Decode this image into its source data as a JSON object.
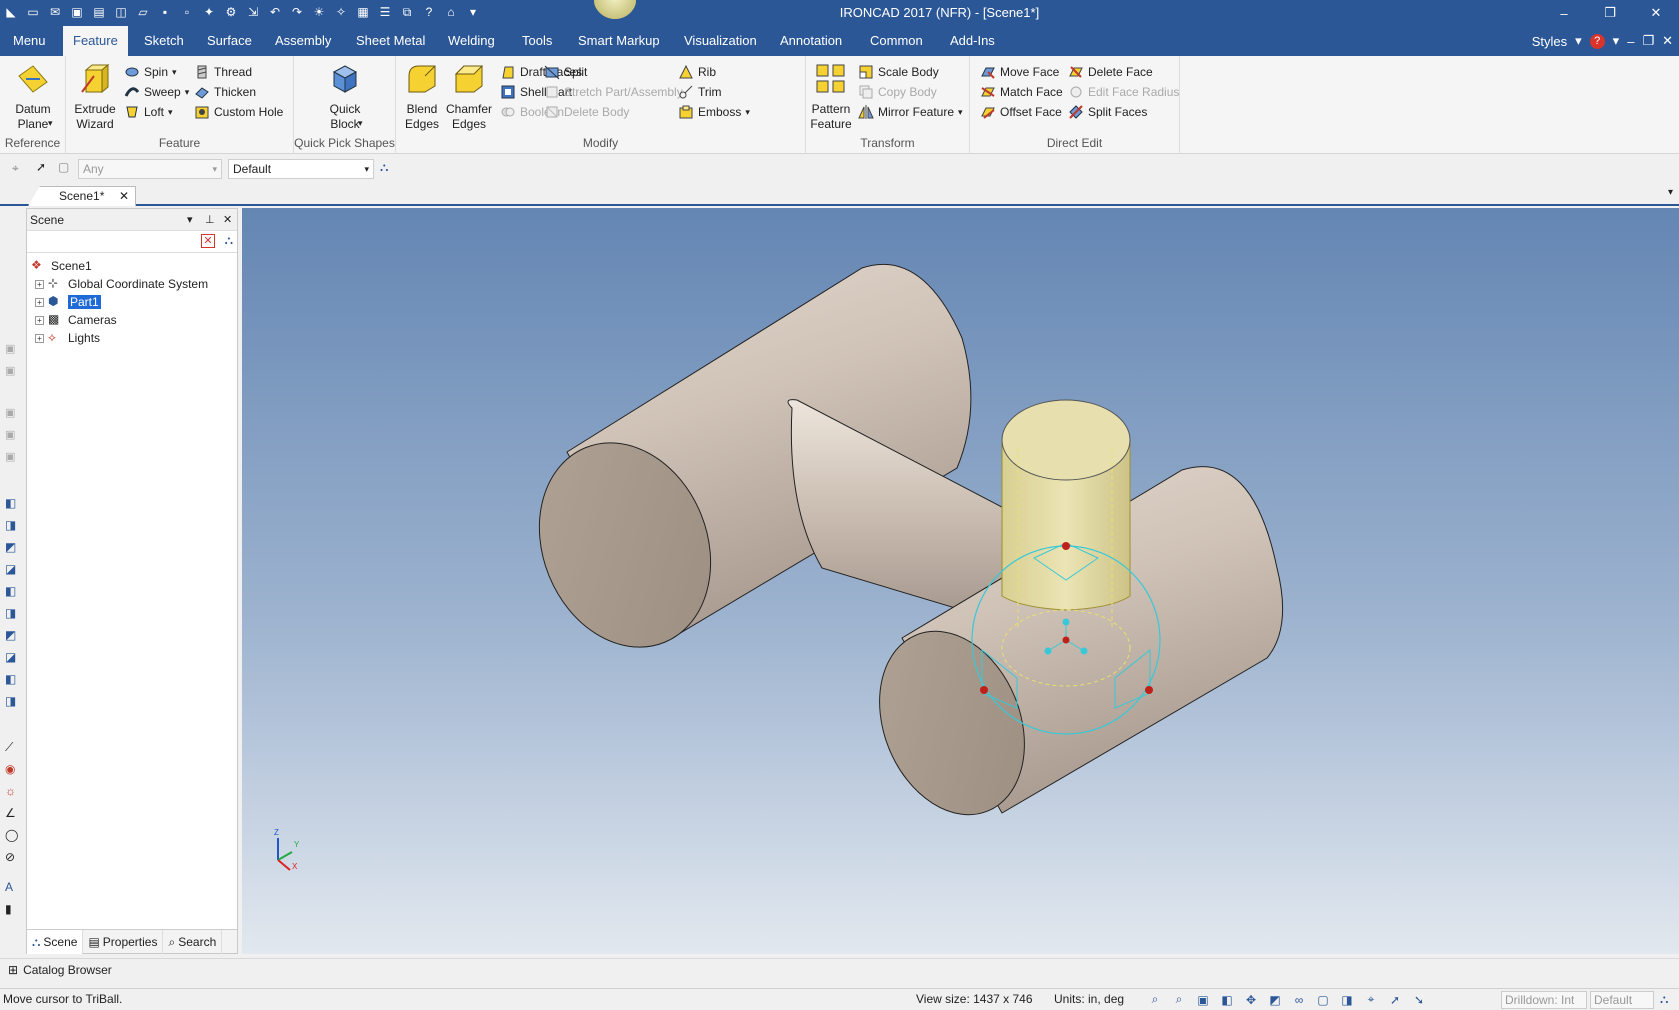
{
  "window": {
    "title": "IRONCAD 2017 (NFR) - [Scene1*]",
    "minimize": "–",
    "restore": "❐",
    "close": "✕"
  },
  "tabs": {
    "items": [
      "Menu",
      "Feature",
      "Sketch",
      "Surface",
      "Assembly",
      "Sheet Metal",
      "Welding",
      "Tools",
      "Smart Markup",
      "Visualization",
      "Annotation",
      "Common",
      "Add-Ins"
    ],
    "active": "Feature",
    "styles_label": "Styles",
    "help_glyph": "?"
  },
  "ribbon": {
    "reference": {
      "label": "Reference",
      "datum_plane": "Datum\nPlane"
    },
    "feature": {
      "label": "Feature",
      "extrude_wizard": "Extrude\nWizard",
      "spin": "Spin",
      "sweep": "Sweep",
      "loft": "Loft",
      "thread": "Thread",
      "thicken": "Thicken",
      "custom_hole": "Custom Hole"
    },
    "quick_pick": {
      "label": "Quick Pick Shapes",
      "quick_block": "Quick\nBlock"
    },
    "modify": {
      "label": "Modify",
      "blend_edges": "Blend\nEdges",
      "chamfer_edges": "Chamfer\nEdges",
      "draft_faces": "Draft Faces",
      "shell_part": "Shell Part",
      "boolean": "Boolean",
      "split": "Split",
      "stretch_part": "Stretch Part/Assembly",
      "delete_body": "Delete Body",
      "rib": "Rib",
      "trim": "Trim",
      "emboss": "Emboss"
    },
    "transform": {
      "label": "Transform",
      "pattern_feature": "Pattern\nFeature",
      "scale_body": "Scale Body",
      "copy_body": "Copy Body",
      "mirror_feature": "Mirror Feature"
    },
    "direct_edit": {
      "label": "Direct Edit",
      "move_face": "Move Face",
      "match_face": "Match Face",
      "offset_face": "Offset Face",
      "delete_face": "Delete Face",
      "edit_face_radius": "Edit Face Radius",
      "split_faces": "Split Faces"
    }
  },
  "selection_toolbar": {
    "filter_value": "Any",
    "style_value": "Default"
  },
  "document_tab": {
    "name": "Scene1*",
    "close": "✕"
  },
  "scene_panel": {
    "title": "Scene",
    "tree": [
      {
        "label": "Scene1",
        "icon": "scene-icon"
      },
      {
        "label": "Global Coordinate System",
        "icon": "coordinate-system-icon"
      },
      {
        "label": "Part1",
        "icon": "part-icon",
        "selected": true
      },
      {
        "label": "Cameras",
        "icon": "camera-icon"
      },
      {
        "label": "Lights",
        "icon": "light-icon"
      }
    ],
    "footer_tabs": [
      "Scene",
      "Properties",
      "Search"
    ]
  },
  "viewport": {
    "triad_labels": {
      "z": "Z",
      "y": "Y",
      "x": "X"
    }
  },
  "catalog": {
    "label": "Catalog Browser"
  },
  "status": {
    "message": "Move cursor to TriBall.",
    "view_size": "View size: 1437 x  746",
    "units": "Units: in, deg",
    "drilldown": "Drilldown: Int",
    "default": "Default"
  },
  "colors": {
    "accent": "#2b5797",
    "part_body": "#c9bcb1",
    "selected_feature": "#e6dfa6",
    "triball": "#38c8d8"
  }
}
